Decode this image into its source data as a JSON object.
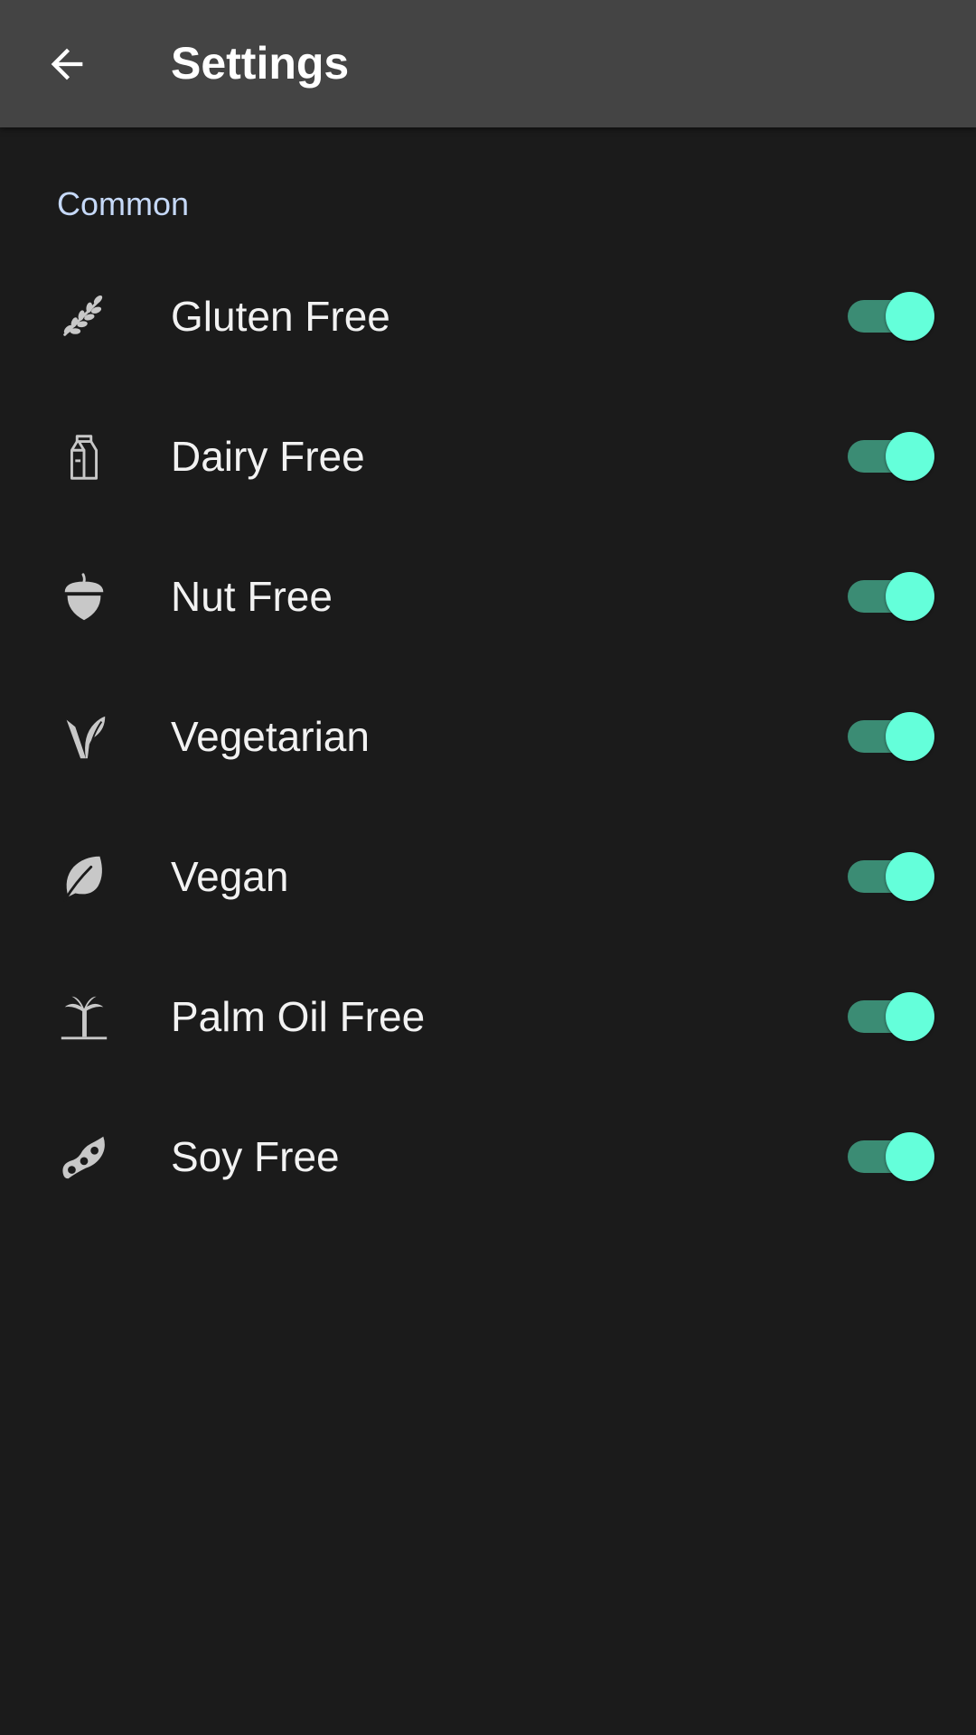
{
  "app_bar": {
    "title": "Settings",
    "back_icon": "arrow-back-icon"
  },
  "section": {
    "header": "Common"
  },
  "settings": [
    {
      "label": "Gluten Free",
      "icon": "wheat-icon",
      "enabled": true
    },
    {
      "label": "Dairy Free",
      "icon": "milk-carton-icon",
      "enabled": true
    },
    {
      "label": "Nut Free",
      "icon": "acorn-icon",
      "enabled": true
    },
    {
      "label": "Vegetarian",
      "icon": "sprout-icon",
      "enabled": true
    },
    {
      "label": "Vegan",
      "icon": "leaf-icon",
      "enabled": true
    },
    {
      "label": "Palm Oil Free",
      "icon": "palm-tree-icon",
      "enabled": true
    },
    {
      "label": "Soy Free",
      "icon": "soybean-icon",
      "enabled": true
    }
  ],
  "colors": {
    "app_bar": "#444444",
    "background": "#1b1b1b",
    "section_header": "#c6d9f8",
    "toggle_thumb": "#64ffda",
    "toggle_track": "#3b8c74",
    "icon": "#c8c8c8"
  }
}
